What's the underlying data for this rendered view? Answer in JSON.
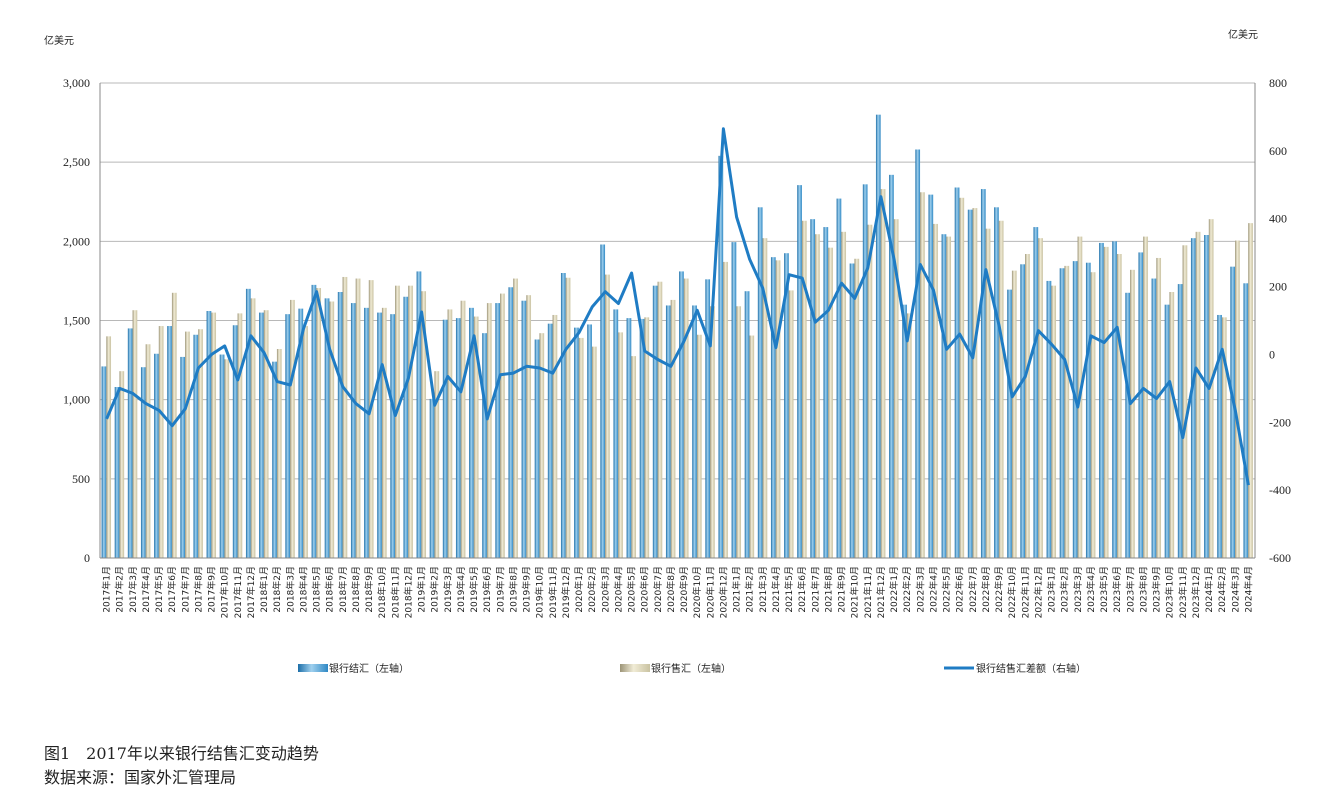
{
  "figure": {
    "title": "图1　2017年以来银行结售汇变动趋势",
    "source": "数据来源：国家外汇管理局"
  },
  "colors": {
    "settlement": "#2f88c4",
    "settlement_highlight": "#9fd0ee",
    "sales": "#d6d0b4",
    "sales_shadow": "#9c9477",
    "balance_line": "#1f7cc4",
    "grid": "#b8b8b8"
  },
  "chart_data": {
    "type": "bar+line",
    "left_axis": {
      "unit": "亿美元",
      "min": 0,
      "max": 3000,
      "ticks": [
        0,
        500,
        1000,
        1500,
        2000,
        2500,
        3000
      ],
      "tick_labels": [
        "0",
        "500",
        "1,000",
        "1,500",
        "2,000",
        "2,500",
        "3,000"
      ]
    },
    "right_axis": {
      "unit": "亿美元",
      "min": -600,
      "max": 800,
      "ticks": [
        -600,
        -400,
        -200,
        0,
        200,
        400,
        600,
        800
      ],
      "tick_labels": [
        "-600",
        "-400",
        "-200",
        "0",
        "200",
        "400",
        "600",
        "800"
      ]
    },
    "grid": true,
    "legend_position": "bottom",
    "categories": [
      "2017年1月",
      "2017年2月",
      "2017年3月",
      "2017年4月",
      "2017年5月",
      "2017年6月",
      "2017年7月",
      "2017年8月",
      "2017年9月",
      "2017年10月",
      "2017年11月",
      "2017年12月",
      "2018年1月",
      "2018年2月",
      "2018年3月",
      "2018年4月",
      "2018年5月",
      "2018年6月",
      "2018年7月",
      "2018年8月",
      "2018年9月",
      "2018年10月",
      "2018年11月",
      "2018年12月",
      "2019年1月",
      "2019年2月",
      "2019年3月",
      "2019年4月",
      "2019年5月",
      "2019年6月",
      "2019年7月",
      "2019年8月",
      "2019年9月",
      "2019年10月",
      "2019年11月",
      "2019年12月",
      "2020年1月",
      "2020年2月",
      "2020年3月",
      "2020年4月",
      "2020年5月",
      "2020年6月",
      "2020年7月",
      "2020年8月",
      "2020年9月",
      "2020年10月",
      "2020年11月",
      "2020年12月",
      "2021年1月",
      "2021年2月",
      "2021年3月",
      "2021年4月",
      "2021年5月",
      "2021年6月",
      "2021年7月",
      "2021年8月",
      "2021年9月",
      "2021年10月",
      "2021年11月",
      "2021年12月",
      "2022年1月",
      "2022年2月",
      "2022年3月",
      "2022年4月",
      "2022年5月",
      "2022年6月",
      "2022年7月",
      "2022年8月",
      "2022年9月",
      "2022年10月",
      "2022年11月",
      "2022年12月",
      "2023年1月",
      "2023年2月",
      "2023年3月",
      "2023年4月",
      "2023年5月",
      "2023年6月",
      "2023年7月",
      "2023年8月",
      "2023年9月",
      "2023年10月",
      "2023年11月",
      "2023年12月",
      "2024年1月",
      "2024年2月",
      "2024年3月",
      "2024年4月"
    ],
    "series": [
      {
        "name": "银行结汇（左轴）",
        "axis": "left",
        "type": "bar",
        "values": [
          1210,
          1080,
          1450,
          1205,
          1290,
          1465,
          1270,
          1410,
          1560,
          1285,
          1470,
          1700,
          1550,
          1240,
          1540,
          1575,
          1725,
          1640,
          1680,
          1610,
          1580,
          1550,
          1540,
          1650,
          1810,
          1005,
          1505,
          1515,
          1580,
          1420,
          1610,
          1710,
          1625,
          1380,
          1480,
          1800,
          1455,
          1475,
          1980,
          1570,
          1515,
          1510,
          1720,
          1595,
          1810,
          1595,
          1760,
          2540,
          1995,
          1685,
          2215,
          1900,
          1925,
          2355,
          2140,
          2090,
          2270,
          1860,
          2360,
          2800,
          2420,
          1600,
          2580,
          2295,
          2045,
          2340,
          2200,
          2330,
          2215,
          1695,
          1855,
          2090,
          1750,
          1830,
          1875,
          1865,
          1990,
          2000,
          1675,
          1930,
          1765,
          1600,
          1730,
          2020,
          2040,
          1535,
          1840,
          1735
        ]
      },
      {
        "name": "银行售汇（左轴）",
        "axis": "left",
        "type": "bar",
        "values": [
          1400,
          1180,
          1565,
          1350,
          1465,
          1675,
          1430,
          1445,
          1550,
          1255,
          1545,
          1640,
          1565,
          1320,
          1630,
          1465,
          1705,
          1620,
          1775,
          1765,
          1755,
          1580,
          1720,
          1720,
          1685,
          1180,
          1570,
          1625,
          1525,
          1610,
          1670,
          1765,
          1660,
          1420,
          1535,
          1770,
          1390,
          1335,
          1790,
          1425,
          1275,
          1520,
          1745,
          1630,
          1765,
          1410,
          1590,
          1870,
          1590,
          1405,
          2020,
          1880,
          1690,
          2130,
          2045,
          1960,
          2060,
          1890,
          2105,
          2330,
          2140,
          1545,
          2310,
          2110,
          2030,
          2275,
          2210,
          2080,
          2130,
          1815,
          1920,
          2020,
          1720,
          1845,
          2030,
          1805,
          1965,
          1920,
          1820,
          2030,
          1895,
          1680,
          1975,
          2060,
          2140,
          1520,
          2005,
          2115
        ]
      },
      {
        "name": "银行结售汇差额（右轴）",
        "axis": "right",
        "type": "line",
        "values": [
          -190,
          -100,
          -115,
          -145,
          -165,
          -210,
          -160,
          -40,
          0,
          25,
          -75,
          55,
          5,
          -80,
          -90,
          75,
          185,
          15,
          -95,
          -145,
          -175,
          -30,
          -180,
          -70,
          125,
          -150,
          -65,
          -110,
          55,
          -190,
          -60,
          -55,
          -35,
          -40,
          -55,
          15,
          65,
          140,
          185,
          150,
          240,
          10,
          -15,
          -35,
          40,
          130,
          25,
          665,
          405,
          280,
          195,
          20,
          235,
          225,
          95,
          130,
          210,
          165,
          255,
          465,
          280,
          40,
          265,
          190,
          15,
          60,
          -10,
          250,
          85,
          -125,
          -65,
          70,
          30,
          -15,
          -155,
          55,
          35,
          80,
          -145,
          -100,
          -130,
          -80,
          -245,
          -40,
          -100,
          15,
          -165,
          -385
        ]
      }
    ],
    "legend": [
      "银行结汇（左轴）",
      "银行售汇（左轴）",
      "银行结售汇差额（右轴）"
    ]
  }
}
